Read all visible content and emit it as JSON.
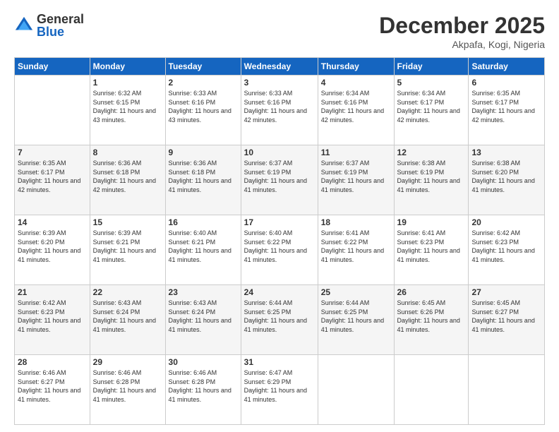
{
  "logo": {
    "general": "General",
    "blue": "Blue"
  },
  "title": "December 2025",
  "location": "Akpafa, Kogi, Nigeria",
  "days_of_week": [
    "Sunday",
    "Monday",
    "Tuesday",
    "Wednesday",
    "Thursday",
    "Friday",
    "Saturday"
  ],
  "weeks": [
    [
      {
        "day": "",
        "sunrise": "",
        "sunset": "",
        "daylight": ""
      },
      {
        "day": "1",
        "sunrise": "Sunrise: 6:32 AM",
        "sunset": "Sunset: 6:15 PM",
        "daylight": "Daylight: 11 hours and 43 minutes."
      },
      {
        "day": "2",
        "sunrise": "Sunrise: 6:33 AM",
        "sunset": "Sunset: 6:16 PM",
        "daylight": "Daylight: 11 hours and 43 minutes."
      },
      {
        "day": "3",
        "sunrise": "Sunrise: 6:33 AM",
        "sunset": "Sunset: 6:16 PM",
        "daylight": "Daylight: 11 hours and 42 minutes."
      },
      {
        "day": "4",
        "sunrise": "Sunrise: 6:34 AM",
        "sunset": "Sunset: 6:16 PM",
        "daylight": "Daylight: 11 hours and 42 minutes."
      },
      {
        "day": "5",
        "sunrise": "Sunrise: 6:34 AM",
        "sunset": "Sunset: 6:17 PM",
        "daylight": "Daylight: 11 hours and 42 minutes."
      },
      {
        "day": "6",
        "sunrise": "Sunrise: 6:35 AM",
        "sunset": "Sunset: 6:17 PM",
        "daylight": "Daylight: 11 hours and 42 minutes."
      }
    ],
    [
      {
        "day": "7",
        "sunrise": "Sunrise: 6:35 AM",
        "sunset": "Sunset: 6:17 PM",
        "daylight": "Daylight: 11 hours and 42 minutes."
      },
      {
        "day": "8",
        "sunrise": "Sunrise: 6:36 AM",
        "sunset": "Sunset: 6:18 PM",
        "daylight": "Daylight: 11 hours and 42 minutes."
      },
      {
        "day": "9",
        "sunrise": "Sunrise: 6:36 AM",
        "sunset": "Sunset: 6:18 PM",
        "daylight": "Daylight: 11 hours and 41 minutes."
      },
      {
        "day": "10",
        "sunrise": "Sunrise: 6:37 AM",
        "sunset": "Sunset: 6:19 PM",
        "daylight": "Daylight: 11 hours and 41 minutes."
      },
      {
        "day": "11",
        "sunrise": "Sunrise: 6:37 AM",
        "sunset": "Sunset: 6:19 PM",
        "daylight": "Daylight: 11 hours and 41 minutes."
      },
      {
        "day": "12",
        "sunrise": "Sunrise: 6:38 AM",
        "sunset": "Sunset: 6:19 PM",
        "daylight": "Daylight: 11 hours and 41 minutes."
      },
      {
        "day": "13",
        "sunrise": "Sunrise: 6:38 AM",
        "sunset": "Sunset: 6:20 PM",
        "daylight": "Daylight: 11 hours and 41 minutes."
      }
    ],
    [
      {
        "day": "14",
        "sunrise": "Sunrise: 6:39 AM",
        "sunset": "Sunset: 6:20 PM",
        "daylight": "Daylight: 11 hours and 41 minutes."
      },
      {
        "day": "15",
        "sunrise": "Sunrise: 6:39 AM",
        "sunset": "Sunset: 6:21 PM",
        "daylight": "Daylight: 11 hours and 41 minutes."
      },
      {
        "day": "16",
        "sunrise": "Sunrise: 6:40 AM",
        "sunset": "Sunset: 6:21 PM",
        "daylight": "Daylight: 11 hours and 41 minutes."
      },
      {
        "day": "17",
        "sunrise": "Sunrise: 6:40 AM",
        "sunset": "Sunset: 6:22 PM",
        "daylight": "Daylight: 11 hours and 41 minutes."
      },
      {
        "day": "18",
        "sunrise": "Sunrise: 6:41 AM",
        "sunset": "Sunset: 6:22 PM",
        "daylight": "Daylight: 11 hours and 41 minutes."
      },
      {
        "day": "19",
        "sunrise": "Sunrise: 6:41 AM",
        "sunset": "Sunset: 6:23 PM",
        "daylight": "Daylight: 11 hours and 41 minutes."
      },
      {
        "day": "20",
        "sunrise": "Sunrise: 6:42 AM",
        "sunset": "Sunset: 6:23 PM",
        "daylight": "Daylight: 11 hours and 41 minutes."
      }
    ],
    [
      {
        "day": "21",
        "sunrise": "Sunrise: 6:42 AM",
        "sunset": "Sunset: 6:23 PM",
        "daylight": "Daylight: 11 hours and 41 minutes."
      },
      {
        "day": "22",
        "sunrise": "Sunrise: 6:43 AM",
        "sunset": "Sunset: 6:24 PM",
        "daylight": "Daylight: 11 hours and 41 minutes."
      },
      {
        "day": "23",
        "sunrise": "Sunrise: 6:43 AM",
        "sunset": "Sunset: 6:24 PM",
        "daylight": "Daylight: 11 hours and 41 minutes."
      },
      {
        "day": "24",
        "sunrise": "Sunrise: 6:44 AM",
        "sunset": "Sunset: 6:25 PM",
        "daylight": "Daylight: 11 hours and 41 minutes."
      },
      {
        "day": "25",
        "sunrise": "Sunrise: 6:44 AM",
        "sunset": "Sunset: 6:25 PM",
        "daylight": "Daylight: 11 hours and 41 minutes."
      },
      {
        "day": "26",
        "sunrise": "Sunrise: 6:45 AM",
        "sunset": "Sunset: 6:26 PM",
        "daylight": "Daylight: 11 hours and 41 minutes."
      },
      {
        "day": "27",
        "sunrise": "Sunrise: 6:45 AM",
        "sunset": "Sunset: 6:27 PM",
        "daylight": "Daylight: 11 hours and 41 minutes."
      }
    ],
    [
      {
        "day": "28",
        "sunrise": "Sunrise: 6:46 AM",
        "sunset": "Sunset: 6:27 PM",
        "daylight": "Daylight: 11 hours and 41 minutes."
      },
      {
        "day": "29",
        "sunrise": "Sunrise: 6:46 AM",
        "sunset": "Sunset: 6:28 PM",
        "daylight": "Daylight: 11 hours and 41 minutes."
      },
      {
        "day": "30",
        "sunrise": "Sunrise: 6:46 AM",
        "sunset": "Sunset: 6:28 PM",
        "daylight": "Daylight: 11 hours and 41 minutes."
      },
      {
        "day": "31",
        "sunrise": "Sunrise: 6:47 AM",
        "sunset": "Sunset: 6:29 PM",
        "daylight": "Daylight: 11 hours and 41 minutes."
      },
      {
        "day": "",
        "sunrise": "",
        "sunset": "",
        "daylight": ""
      },
      {
        "day": "",
        "sunrise": "",
        "sunset": "",
        "daylight": ""
      },
      {
        "day": "",
        "sunrise": "",
        "sunset": "",
        "daylight": ""
      }
    ]
  ]
}
